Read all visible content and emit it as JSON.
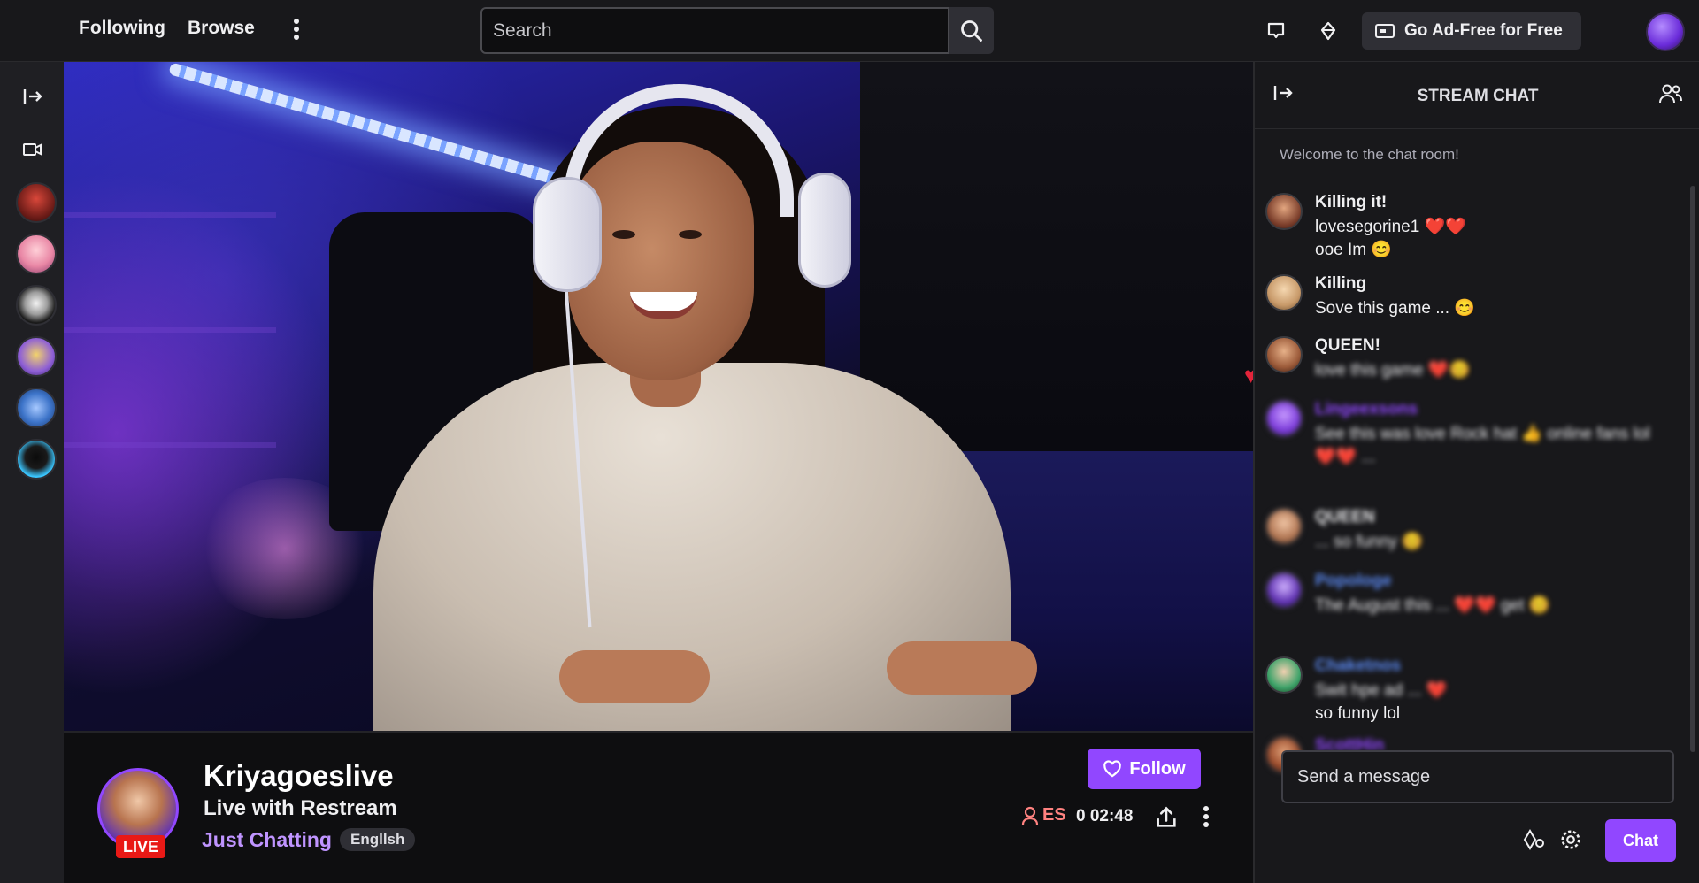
{
  "nav": {
    "following": "Following",
    "browse": "Browse",
    "search_placeholder": "Search",
    "adfree_label": "Go Ad-Free for Free"
  },
  "stream": {
    "streamer": "Kriyagoeslive",
    "title": "Live with Restream",
    "category": "Just Chatting",
    "tag": "Engllsh",
    "live_label": "LIVE",
    "viewers": "ES",
    "uptime": "0 02:48",
    "follow_label": "Follow"
  },
  "chat": {
    "title": "STREAM CHAT",
    "welcome": "Welcome to the chat room!",
    "input_placeholder": "Send a message",
    "send_label": "Chat",
    "messages": [
      {
        "name": "Killing it!",
        "text": "lovesegorine1 ❤️❤️",
        "text2": "ooe Im 😊",
        "name_color": "#efeff1"
      },
      {
        "name": "Killing",
        "text": "Sove this game ... 😊",
        "name_color": "#efeff1"
      },
      {
        "name": "QUEEN!",
        "text": "love this game ❤️😊",
        "name_color": "#efeff1"
      },
      {
        "name": "Lingeexsons",
        "text": "See this was love Rock hat 👍 online fans lol ❤️❤️ ... ",
        "name_color": "#9147ff"
      },
      {
        "name": "QUEEN",
        "text": "... so funny 😊",
        "name_color": "#efeff1"
      },
      {
        "name": "Popologe",
        "text": "The August this ... ❤️❤️ get 😊",
        "name_color": "#5c8bf5"
      },
      {
        "name": "Chaketnos",
        "text": "Swit hpe ad ... ❤️",
        "text2": "so funny lol",
        "name_color": "#5c8bf5"
      },
      {
        "name": "ScottHin",
        "text": "",
        "name_color": "#9147ff"
      }
    ]
  },
  "icons": {
    "search": "search-icon",
    "inbox": "inbox-icon",
    "crown": "prime-crown-icon",
    "heart": "heart-icon"
  },
  "colors": {
    "accent": "#9147ff",
    "live": "#e91916",
    "heart": "#ec3b4d"
  }
}
